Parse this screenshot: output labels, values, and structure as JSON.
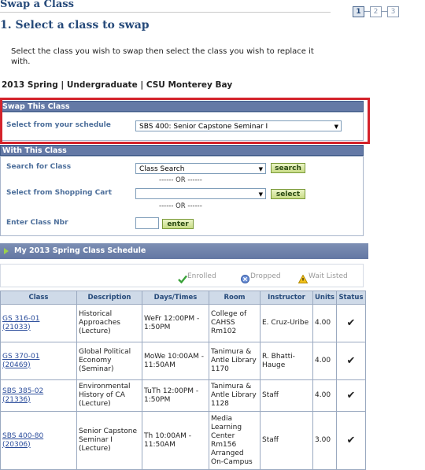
{
  "page": {
    "title": "Swap a Class"
  },
  "steps": [
    "1",
    "2",
    "3"
  ],
  "step_heading": "1.  Select a class to swap",
  "instructions": "Select the class you wish to swap then select the class you wish to replace it with.",
  "term_line": "2013 Spring | Undergraduate | CSU Monterey Bay",
  "swap_section": {
    "header": "Swap This Class",
    "label": "Select from your schedule",
    "selected": "SBS 400: Senior Capstone Seminar I"
  },
  "with_section": {
    "header": "With This Class",
    "search_label": "Search for Class",
    "search_select": "Class Search",
    "search_button": "search",
    "or_1": "------ OR ------",
    "cart_label": "Select from Shopping Cart",
    "cart_select": "",
    "select_button": "select",
    "or_2": "------ OR ------",
    "nbr_label": "Enter Class Nbr",
    "nbr_value": "",
    "enter_button": "enter"
  },
  "schedule": {
    "header": "My 2013 Spring Class Schedule",
    "legend": {
      "enrolled": "Enrolled",
      "dropped": "Dropped",
      "wait": "Wait Listed"
    },
    "columns": [
      "Class",
      "Description",
      "Days/Times",
      "Room",
      "Instructor",
      "Units",
      "Status"
    ],
    "rows": [
      {
        "class": "GS 316-01",
        "nbr": "(21033)",
        "description": "Historical Approaches (Lecture)",
        "days": "WeFr 12:00PM - 1:50PM",
        "room": "College of CAHSS Rm102",
        "instructor": "E. Cruz-Uribe",
        "units": "4.00",
        "status": "Enrolled"
      },
      {
        "class": "GS 370-01",
        "nbr": "(20469)",
        "description": "Global Political Economy (Seminar)",
        "days": "MoWe 10:00AM - 11:50AM",
        "room": "Tanimura & Antle Library 1170",
        "instructor": "R. Bhatti-Hauge",
        "units": "4.00",
        "status": "Enrolled"
      },
      {
        "class": "SBS 385-02",
        "nbr": "(21336)",
        "description": "Environmental History of CA (Lecture)",
        "days": "TuTh 12:00PM - 1:50PM",
        "room": "Tanimura & Antle Library 1128",
        "instructor": "Staff",
        "units": "4.00",
        "status": "Enrolled"
      },
      {
        "class": "SBS 400-80",
        "nbr": "(20306)",
        "description": "Senior Capstone Seminar I (Lecture)",
        "days": "Th 10:00AM - 11:50AM",
        "room": "Media Learning Center Rm156 Arranged On-Campus",
        "instructor": "Staff",
        "units": "3.00",
        "status": "Enrolled"
      }
    ]
  },
  "colors": {
    "accent": "#264a7a",
    "section_bar": "#6479a6",
    "highlight": "#d4232b",
    "enrolled": "#3aa23a"
  }
}
